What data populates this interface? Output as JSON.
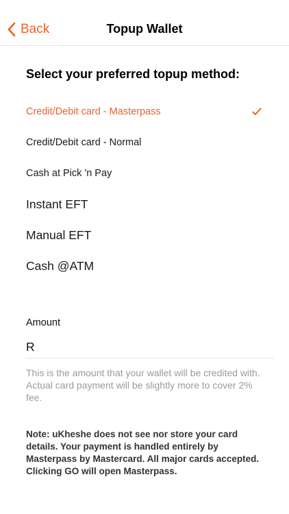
{
  "header": {
    "back_label": "Back",
    "title": "Topup Wallet"
  },
  "heading": "Select your preferred topup method:",
  "methods": [
    {
      "label": "Credit/Debit card - Masterpass",
      "selected": true
    },
    {
      "label": "Credit/Debit card - Normal",
      "selected": false
    },
    {
      "label": "Cash at Pick 'n Pay",
      "selected": false
    },
    {
      "label": "Instant EFT",
      "selected": false
    },
    {
      "label": "Manual EFT",
      "selected": false
    },
    {
      "label": "Cash @ATM",
      "selected": false
    }
  ],
  "amount": {
    "label": "Amount",
    "prefix": "R",
    "value": ""
  },
  "hint": "This is the amount that your wallet will be credited with. Actual card payment will be slightly more to cover 2% fee.",
  "note": {
    "line1": "Note: uKheshe does not see nor store your card details. Your payment is handled entirely by Masterpass by Mastercard. All major cards accepted.",
    "line2": "Clicking GO will open Masterpass."
  },
  "icons": {
    "back": "chevron-left-icon",
    "selected": "checkmark-icon"
  },
  "colors": {
    "accent": "#e8632b",
    "text": "#1a1a1a",
    "hint": "#9a9a9a",
    "divider": "#e3e3e3"
  }
}
